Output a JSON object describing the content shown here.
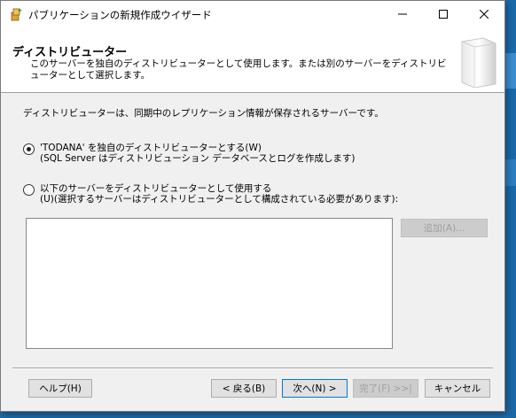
{
  "window": {
    "title": "パブリケーションの新規作成ウイザード"
  },
  "header": {
    "title": "ディストリビューター",
    "description": "このサーバーを独自のディストリビューターとして使用します。または別のサーバーをディストリビューターとして選択します。"
  },
  "content": {
    "description": "ディストリビューターは、同期中のレプリケーション情報が保存されるサーバーです。",
    "options": [
      {
        "line1": "'TODANA' を独自のディストリビューターとする(W)",
        "line2": "(SQL Server はディストリビューション データベースとログを作成します)",
        "checked": true
      },
      {
        "line1": "以下のサーバーをディストリビューターとして使用する",
        "line2": "(U)(選択するサーバーはディストリビューターとして構成されている必要があります):",
        "checked": false
      }
    ],
    "add_button": "追加(A)..."
  },
  "footer": {
    "help": "ヘルプ(H)",
    "back": "< 戻る(B)",
    "next": "次へ(N) >",
    "finish": "完了(F) >>|",
    "cancel": "キャンセル"
  },
  "icons": {
    "title": "wizard-icon",
    "header_art": "server-icon"
  },
  "colors": {
    "accent": "#0078d7",
    "window_bg": "#f0f0f0",
    "desktop": "#1b6aa8"
  }
}
